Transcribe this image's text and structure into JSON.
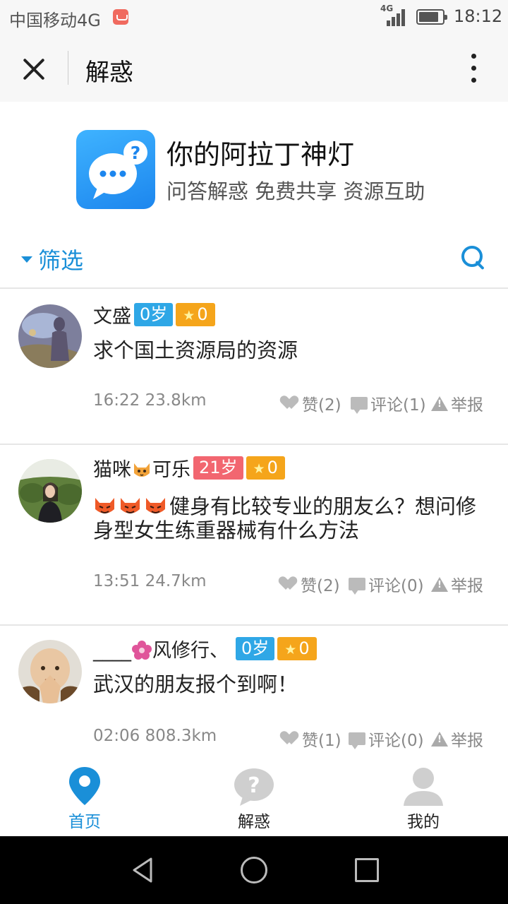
{
  "status_bar": {
    "carrier": "中国移动4G",
    "network": "4G",
    "time": "18:12",
    "battery_level": 0.85
  },
  "title_bar": {
    "title": "解惑",
    "close_icon": "close-icon",
    "more_icon": "more-vertical-icon"
  },
  "app_header": {
    "name": "你的阿拉丁神灯",
    "slogan": "问答解惑 免费共享 资源互助",
    "logo_icon": "chat-bubble-question-icon",
    "logo_color": "#2c9cf7"
  },
  "filter_bar": {
    "filter_label": "筛选",
    "search_icon": "search-icon",
    "accent_color": "#1a8fd8"
  },
  "posts": [
    {
      "user_name": "文盛",
      "age_badge": "0岁",
      "age_badge_color": "#2fa7e6",
      "star_count": "0",
      "text": "求个国土资源局的资源",
      "time": "16:22",
      "distance": "23.8km",
      "like_label": "赞(2)",
      "comment_label": "评论(1)",
      "report_label": "举报"
    },
    {
      "user_name_prefix": "猫咪",
      "user_name_suffix": "可乐",
      "age_badge": "21岁",
      "age_badge_color": "#f26670",
      "star_count": "0",
      "text": "健身有比较专业的朋友么？想问修身型女生练重器械有什么方法",
      "time": "13:51",
      "distance": "24.7km",
      "like_label": "赞(2)",
      "comment_label": "评论(0)",
      "report_label": "举报"
    },
    {
      "user_name_prefix": "____",
      "user_name_suffix": "风修行、",
      "age_badge": "0岁",
      "age_badge_color": "#2fa7e6",
      "star_count": "0",
      "text": "武汉的朋友报个到啊！",
      "time": "02:06",
      "distance": "808.3km",
      "like_label": "赞(1)",
      "comment_label": "评论(0)",
      "report_label": "举报"
    }
  ],
  "tab_bar": {
    "tabs": [
      {
        "label": "首页",
        "icon": "location-pin-icon",
        "active": true
      },
      {
        "label": "解惑",
        "icon": "question-bubble-icon",
        "active": false
      },
      {
        "label": "我的",
        "icon": "user-icon",
        "active": false
      }
    ],
    "active_color": "#1a8fd8",
    "inactive_color": "#222222"
  },
  "system_nav": {
    "back_icon": "back-triangle-icon",
    "home_icon": "home-circle-icon",
    "recent_icon": "recent-apps-square-icon"
  }
}
